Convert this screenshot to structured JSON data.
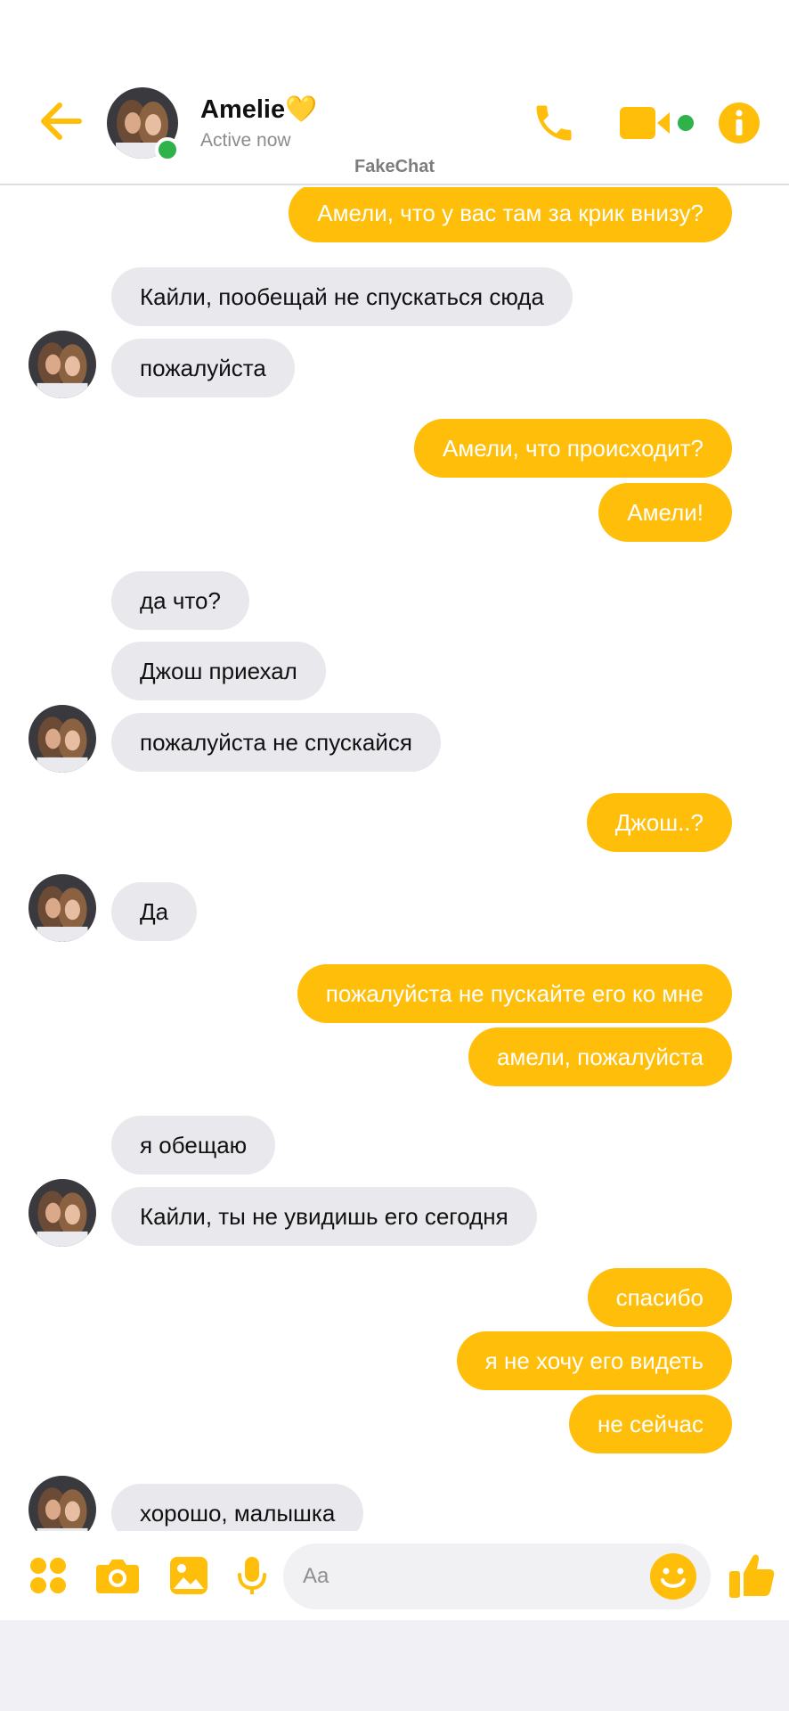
{
  "app": {
    "watermark": "FakeChat",
    "accent": "#ffbe0a"
  },
  "header": {
    "contact_name": "Amelie💛",
    "status": "Active now",
    "icons": [
      "back-arrow-icon",
      "phone-icon",
      "video-camera-icon",
      "info-icon"
    ]
  },
  "messages": [
    {
      "dir": "out",
      "text": "Амели, что у вас там за крик внизу?"
    },
    {
      "dir": "in",
      "text": "Кайли, пообещай не спускаться сюда"
    },
    {
      "dir": "in",
      "text": "пожалуйста",
      "avatar": true
    },
    {
      "dir": "out",
      "text": "Амели, что происходит?"
    },
    {
      "dir": "out",
      "text": "Амели!"
    },
    {
      "dir": "in",
      "text": "да что?"
    },
    {
      "dir": "in",
      "text": "Джош приехал"
    },
    {
      "dir": "in",
      "text": "пожалуйста не спускайся",
      "avatar": true
    },
    {
      "dir": "out",
      "text": "Джош..?"
    },
    {
      "dir": "in",
      "text": "Да",
      "avatar": true
    },
    {
      "dir": "out",
      "text": "пожалуйста не пускайте его ко мне"
    },
    {
      "dir": "out",
      "text": "амели, пожалуйста"
    },
    {
      "dir": "in",
      "text": "я обещаю"
    },
    {
      "dir": "in",
      "text": "Кайли, ты не увидишь его сегодня",
      "avatar": true
    },
    {
      "dir": "out",
      "text": "спасибо"
    },
    {
      "dir": "out",
      "text": "я не хочу его видеть"
    },
    {
      "dir": "out",
      "text": "не сейчас"
    },
    {
      "dir": "in",
      "text": "хорошо, малышка",
      "avatar": true
    }
  ],
  "composer": {
    "placeholder": "Aa",
    "icons": [
      "apps-icon",
      "camera-icon",
      "gallery-icon",
      "microphone-icon",
      "emoji-icon",
      "thumbs-up-icon"
    ]
  }
}
